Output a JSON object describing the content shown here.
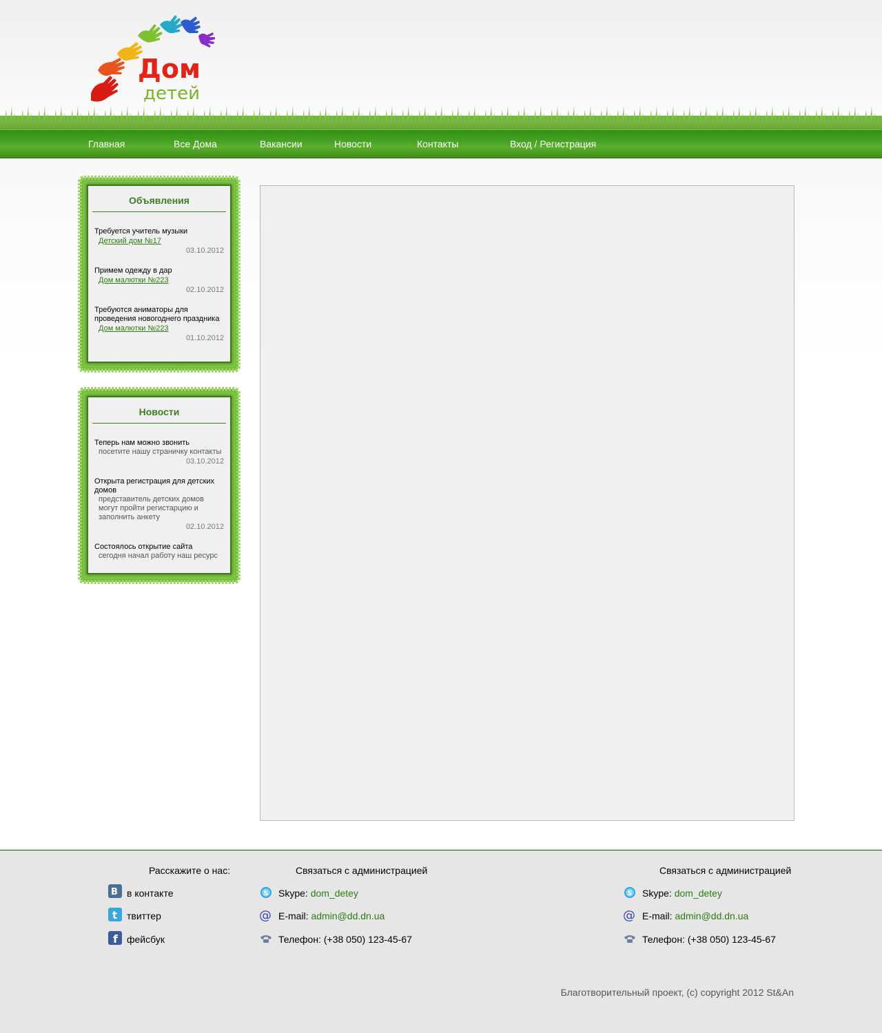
{
  "site": {
    "logo_title": "Дом",
    "logo_subtitle": "детей"
  },
  "nav": {
    "items": [
      {
        "label": "Главная"
      },
      {
        "label": "Все Дома"
      },
      {
        "label": "Вакансии"
      },
      {
        "label": "Новости"
      },
      {
        "label": "Контакты"
      },
      {
        "label": "Вход / Регистрация"
      }
    ]
  },
  "announcements": {
    "title": "Объявления",
    "items": [
      {
        "title": "Требуется учитель музыки",
        "source": "Детский дом №17",
        "date": "03.10.2012"
      },
      {
        "title": "Примем одежду в дар",
        "source": "Дом малютки №223",
        "date": "02.10.2012"
      },
      {
        "title": "Требуются аниматоры для проведения новогоднего праздника",
        "source": "Дом малютки №223",
        "date": "01.10.2012"
      }
    ]
  },
  "news": {
    "title": "Новости",
    "items": [
      {
        "title": "Теперь нам можно звонить",
        "desc": "посетите нашу страничку контакты",
        "date": "03.10.2012"
      },
      {
        "title": "Открыта регистрация для детских домов",
        "desc": "представитель детских домов могут пройти регистарцию и заполнить анкету",
        "date": "02.10.2012"
      },
      {
        "title": "Состоялось открытие сайта",
        "desc": "сегодня начал работу наш  ресурс",
        "date": ""
      }
    ]
  },
  "footer": {
    "share": {
      "heading": "Расскажите о нас:",
      "items": [
        {
          "label": "в контакте",
          "icon": "vk-icon"
        },
        {
          "label": "твиттер",
          "icon": "twitter-icon"
        },
        {
          "label": "фейсбук",
          "icon": "facebook-icon"
        }
      ]
    },
    "contact_left": {
      "heading": "Связаться с администрацией",
      "skype_label": "Skype:",
      "skype_value": "dom_detey",
      "email_label": "E-mail:",
      "email_value": "admin@dd.dn.ua",
      "phone_label": "Телефон:",
      "phone_value": "(+38 050) 123-45-67"
    },
    "contact_right": {
      "heading": "Связаться с администрацией",
      "skype_label": "Skype:",
      "skype_value": "dom_detey",
      "email_label": "E-mail:",
      "email_value": "admin@dd.dn.ua",
      "phone_label": "Телефон:",
      "phone_value": "(+38 050) 123-45-67"
    },
    "copyright": "Благотворительный проект, (c) copyright 2012 St&An"
  },
  "colors": {
    "nav_green": "#4aa524",
    "title_green": "#3e7d22",
    "link_green": "#2c7d0e"
  }
}
